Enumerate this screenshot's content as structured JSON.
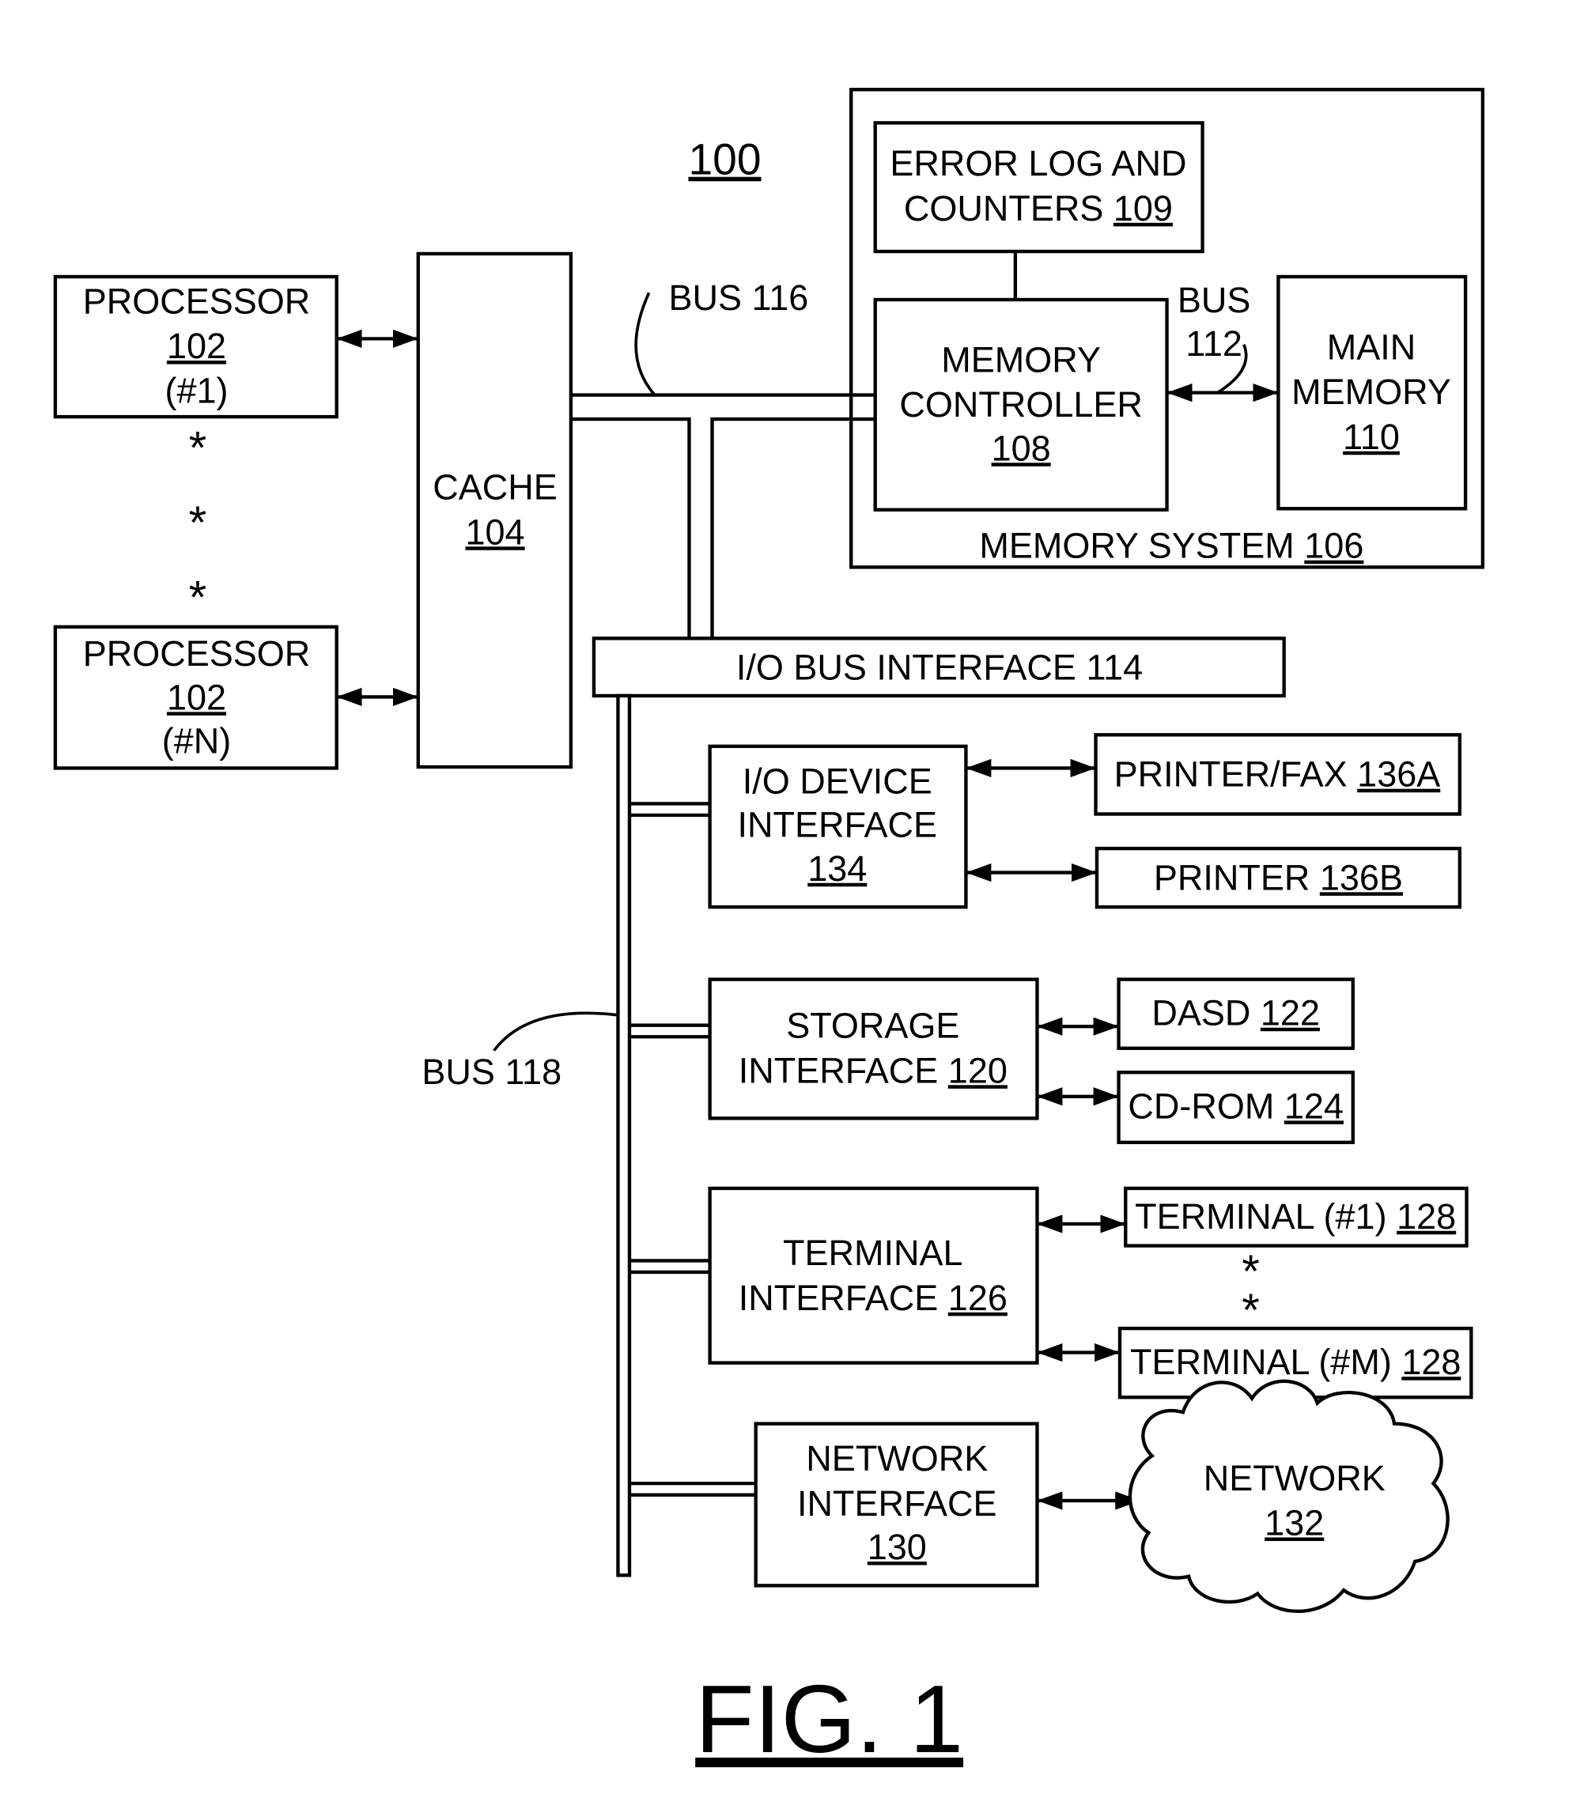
{
  "figure": {
    "number_label": "100",
    "caption": "FIG. 1",
    "text_color": "#000000",
    "background": "#ffffff"
  },
  "blocks": {
    "processor_1": {
      "lines": [
        "PROCESSOR"
      ],
      "ref": "102",
      "suffix": "(#1)"
    },
    "processor_n": {
      "lines": [
        "PROCESSOR"
      ],
      "ref": "102",
      "suffix": "(#N)"
    },
    "cache": {
      "lines": [
        "CACHE"
      ],
      "ref": "104"
    },
    "memory_system": {
      "label": "MEMORY SYSTEM",
      "ref": "106"
    },
    "error_log": {
      "line1": "ERROR LOG AND",
      "line2": "COUNTERS",
      "ref": "109"
    },
    "memory_controller": {
      "line1": "MEMORY",
      "line2": "CONTROLLER",
      "ref": "108"
    },
    "main_memory": {
      "line1": "MAIN",
      "line2": "MEMORY",
      "ref": "110"
    },
    "io_bus_interface": {
      "label": "I/O BUS INTERFACE 114"
    },
    "io_device_interface": {
      "line1": "I/O DEVICE",
      "line2": "INTERFACE",
      "ref": "134"
    },
    "printer_fax": {
      "label": "PRINTER/FAX",
      "ref": "136A"
    },
    "printer": {
      "label": "PRINTER",
      "ref": "136B"
    },
    "storage_interface": {
      "line1": "STORAGE",
      "line2": "INTERFACE",
      "ref": "120"
    },
    "dasd": {
      "label": "DASD",
      "ref": "122"
    },
    "cdrom": {
      "label": "CD-ROM",
      "ref": "124"
    },
    "terminal_interface": {
      "line1": "TERMINAL",
      "line2": "INTERFACE",
      "ref": "126"
    },
    "terminal_1": {
      "label": "TERMINAL (#1)",
      "ref": "128"
    },
    "terminal_m": {
      "label": "TERMINAL (#M)",
      "ref": "128"
    },
    "network_interface": {
      "line1": "NETWORK",
      "line2": "INTERFACE",
      "ref": "130"
    },
    "network": {
      "line1": "NETWORK",
      "ref": "132"
    }
  },
  "buses": {
    "bus_116": "BUS 116",
    "bus_112_line1": "BUS",
    "bus_112_line2": "112",
    "bus_118": "BUS 118"
  },
  "ellipsis_marks": {
    "processor": [
      "*",
      "*",
      "*"
    ],
    "terminal": [
      "*",
      "*"
    ]
  }
}
